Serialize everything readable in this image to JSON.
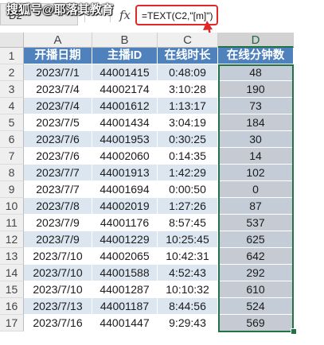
{
  "watermark": "搜狐号@耶落其教育",
  "namebox": {
    "value": "D2"
  },
  "formula_bar": {
    "fx_label": "fx",
    "formula": "=TEXT(C2,\"[m]\")"
  },
  "columns": [
    "A",
    "B",
    "C",
    "D"
  ],
  "rows": [
    "1",
    "2",
    "3",
    "4",
    "5",
    "6",
    "7",
    "8",
    "9",
    "10",
    "11",
    "12",
    "13",
    "14",
    "15",
    "16",
    "17"
  ],
  "headers": [
    "开播日期",
    "主播ID",
    "在线时长",
    "在线分钟数"
  ],
  "table": [
    [
      "2023/7/1",
      "44001415",
      "0:48:09",
      "48"
    ],
    [
      "2023/7/4",
      "44002174",
      "3:10:28",
      "190"
    ],
    [
      "2023/7/4",
      "44001612",
      "1:13:17",
      "73"
    ],
    [
      "2023/7/5",
      "44001434",
      "3:04:19",
      "184"
    ],
    [
      "2023/7/6",
      "44001953",
      "0:30:25",
      "30"
    ],
    [
      "2023/7/6",
      "44002060",
      "0:14:35",
      "14"
    ],
    [
      "2023/7/7",
      "44001913",
      "1:42:29",
      "102"
    ],
    [
      "2023/7/7",
      "44001694",
      "0:00:50",
      "0"
    ],
    [
      "2023/7/8",
      "44002019",
      "1:27:26",
      "87"
    ],
    [
      "2023/7/9",
      "44001176",
      "8:57:45",
      "537"
    ],
    [
      "2023/7/9",
      "44001229",
      "10:25:45",
      "625"
    ],
    [
      "2023/7/10",
      "44002065",
      "10:42:31",
      "642"
    ],
    [
      "2023/7/10",
      "44001588",
      "4:52:43",
      "292"
    ],
    [
      "2023/7/10",
      "44001287",
      "10:10:32",
      "610"
    ],
    [
      "2023/7/13",
      "44001187",
      "8:44:56",
      "524"
    ],
    [
      "2023/7/16",
      "44001447",
      "9:29:43",
      "569"
    ]
  ],
  "colors": {
    "header_fill": "#4f81bd",
    "band_fill": "#dce6f1",
    "selection": "#217346",
    "annotation": "#e12828"
  },
  "icons": {
    "fx": "function-icon",
    "annotation": "arrow-pointer-icon"
  }
}
